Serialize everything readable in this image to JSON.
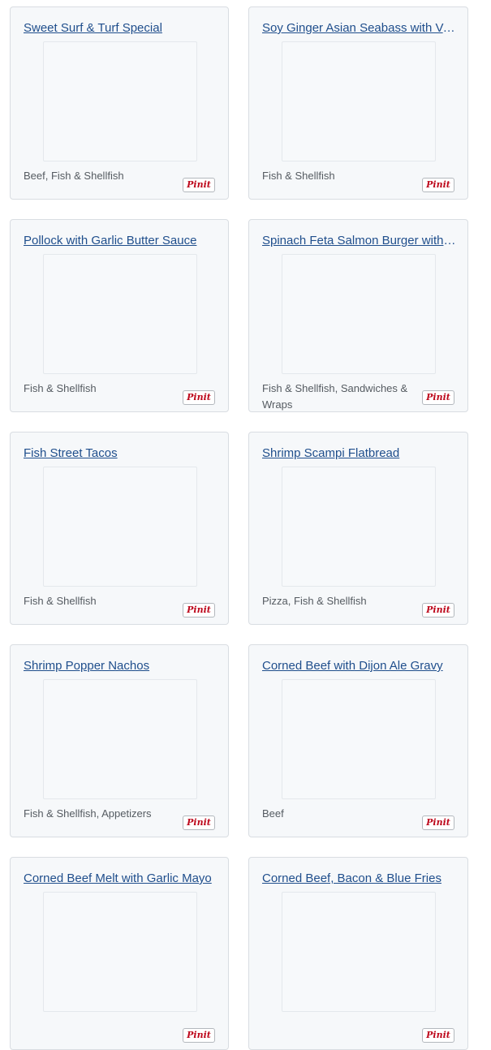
{
  "recipes": [
    {
      "title": "Sweet Surf & Turf Special",
      "category": "Beef, Fish & Shellfish",
      "pin_label": "Pinit"
    },
    {
      "title": "Soy Ginger Asian Seabass with Vegetables",
      "category": "Fish & Shellfish",
      "pin_label": "Pinit"
    },
    {
      "title": "Pollock with Garlic Butter Sauce",
      "category": "Fish & Shellfish",
      "pin_label": "Pinit"
    },
    {
      "title": "Spinach Feta Salmon Burger with Fries",
      "category": "Fish & Shellfish, Sandwiches & Wraps",
      "pin_label": "Pinit"
    },
    {
      "title": "Fish Street Tacos",
      "category": "Fish & Shellfish",
      "pin_label": "Pinit"
    },
    {
      "title": "Shrimp Scampi Flatbread",
      "category": "Pizza, Fish & Shellfish",
      "pin_label": "Pinit"
    },
    {
      "title": "Shrimp Popper Nachos",
      "category": "Fish & Shellfish, Appetizers",
      "pin_label": "Pinit"
    },
    {
      "title": "Corned Beef with Dijon Ale Gravy",
      "category": "Beef",
      "pin_label": "Pinit"
    },
    {
      "title": "Corned Beef Melt with Garlic Mayo",
      "category": "",
      "pin_label": "Pinit"
    },
    {
      "title": "Corned Beef, Bacon & Blue Fries",
      "category": "",
      "pin_label": "Pinit"
    }
  ]
}
